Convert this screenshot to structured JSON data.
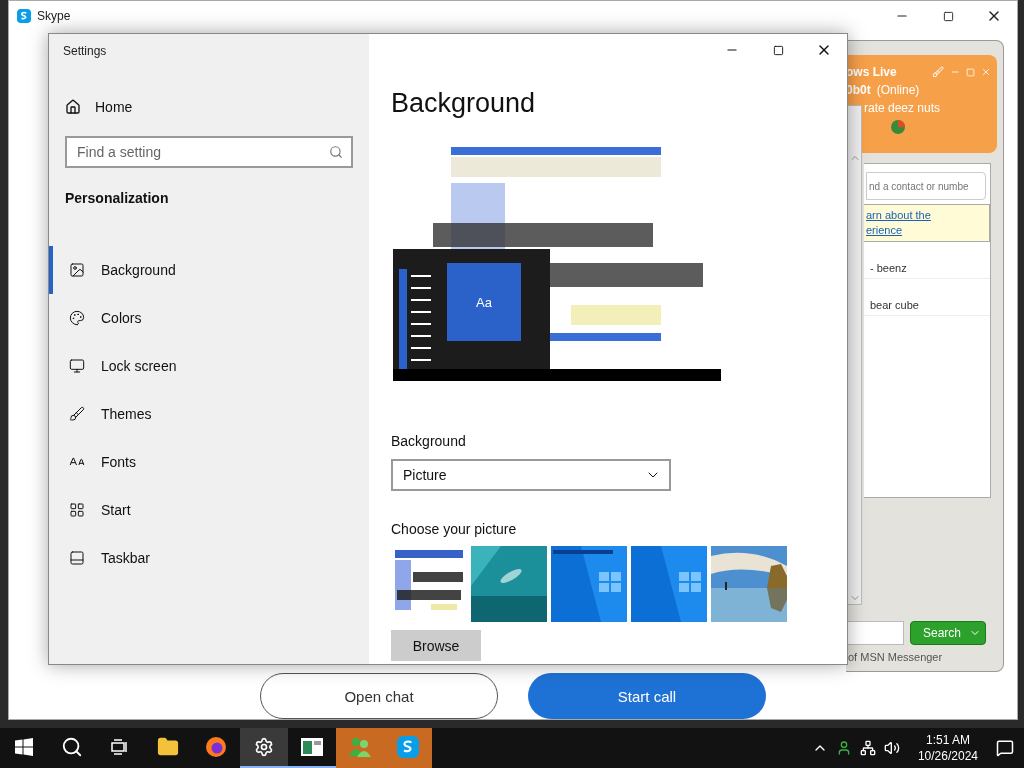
{
  "skype_window": {
    "title": "Skype",
    "buttons": [
      {
        "label": "Open chat",
        "kind": "outline"
      },
      {
        "label": "Start call",
        "kind": "primary"
      }
    ]
  },
  "messenger_window": {
    "title": "ows Live",
    "user": "0b0t",
    "status": "(Online)",
    "personal_message": "rate deez nuts",
    "search_placeholder": "nd a contact or numbe",
    "banner_lines": [
      "arn about the",
      "erience"
    ],
    "contacts": [
      "- beenz",
      "bear cube"
    ],
    "search_button": "Search",
    "footer": "of MSN Messenger"
  },
  "settings_window": {
    "title": "Settings",
    "home": "Home",
    "search_placeholder": "Find a setting",
    "section": "Personalization",
    "nav_items": [
      {
        "label": "Background",
        "selected": true
      },
      {
        "label": "Colors",
        "selected": false
      },
      {
        "label": "Lock screen",
        "selected": false
      },
      {
        "label": "Themes",
        "selected": false
      },
      {
        "label": "Fonts",
        "selected": false
      },
      {
        "label": "Start",
        "selected": false
      },
      {
        "label": "Taskbar",
        "selected": false
      }
    ],
    "page_title": "Background",
    "preview_tile": "Aa",
    "background_label": "Background",
    "background_value": "Picture",
    "choose_label": "Choose your picture",
    "browse_button": "Browse"
  },
  "taskbar": {
    "apps": [
      {
        "kind": "start",
        "selected": false,
        "open": false,
        "flashing": false
      },
      {
        "kind": "search",
        "selected": false,
        "open": false,
        "flashing": false
      },
      {
        "kind": "taskview",
        "selected": false,
        "open": false,
        "flashing": false
      },
      {
        "kind": "explorer",
        "selected": false,
        "open": false,
        "flashing": false
      },
      {
        "kind": "firefox",
        "selected": false,
        "open": false,
        "flashing": false
      },
      {
        "kind": "settings",
        "selected": true,
        "open": true,
        "flashing": false
      },
      {
        "kind": "window",
        "selected": false,
        "open": true,
        "flashing": false
      },
      {
        "kind": "messenger",
        "selected": false,
        "open": true,
        "flashing": true
      },
      {
        "kind": "skype",
        "selected": false,
        "open": true,
        "flashing": true
      }
    ],
    "time": "1:51 AM",
    "date": "10/26/2024"
  }
}
